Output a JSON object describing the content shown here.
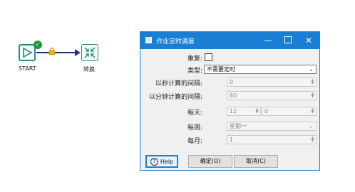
{
  "canvas": {
    "start_node": {
      "label": "START",
      "icon": "play-triangle-icon",
      "status_icon": "check-badge-icon",
      "status_color": "#1e9a3a"
    },
    "transform_node": {
      "label": "转换",
      "icon": "collapse-arrows-icon"
    },
    "hop": {
      "color": "#23337a",
      "lock_icon": "lock-icon",
      "lock_color": "#e0a100"
    }
  },
  "dialog": {
    "title": "作业定时调度",
    "accent": "#1a7fd4",
    "window_controls": {
      "minimize": "—",
      "close": "✕"
    },
    "form": {
      "repeat_label": "重复:",
      "repeat_checked": false,
      "type_label": "类型:",
      "type_value": "不需要定时",
      "seconds_label": "以秒计算的间隔:",
      "seconds_value": "0",
      "minutes_label": "以分钟计算的间隔:",
      "minutes_value": "60",
      "daily_label": "每天:",
      "daily_hour": "12",
      "daily_minute": "0",
      "weekly_label": "每周:",
      "weekly_value": "星期一",
      "monthly_label": "每月:",
      "monthly_value": "1"
    },
    "buttons": {
      "help": "Help",
      "ok": "确定(O)",
      "cancel": "取消(C)"
    }
  }
}
